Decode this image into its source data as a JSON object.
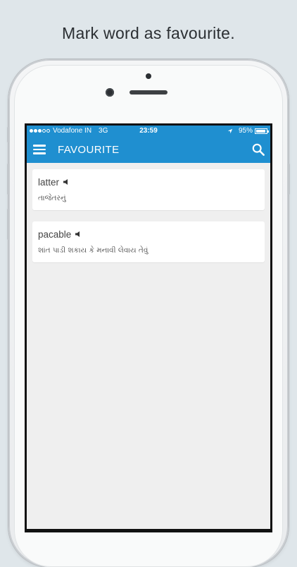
{
  "headline": "Mark word as favourite.",
  "status_bar": {
    "carrier": "Vodafone IN",
    "network": "3G",
    "time": "23:59",
    "battery": "95%",
    "battery_level": 0.95,
    "signal_bars": 3
  },
  "app_bar": {
    "title": "FAVOURITE",
    "menu_icon": "hamburger-menu-icon",
    "search_icon": "search-icon"
  },
  "favourites": [
    {
      "word": "latter",
      "meaning": "તાજેતરનું"
    },
    {
      "word": "pacable",
      "meaning": "શાંત પાડી શકાય કે મનાવી લેવાય તેવું"
    }
  ],
  "colors": {
    "accent": "#1f8fd0",
    "background": "#efefef",
    "card": "#ffffff"
  }
}
